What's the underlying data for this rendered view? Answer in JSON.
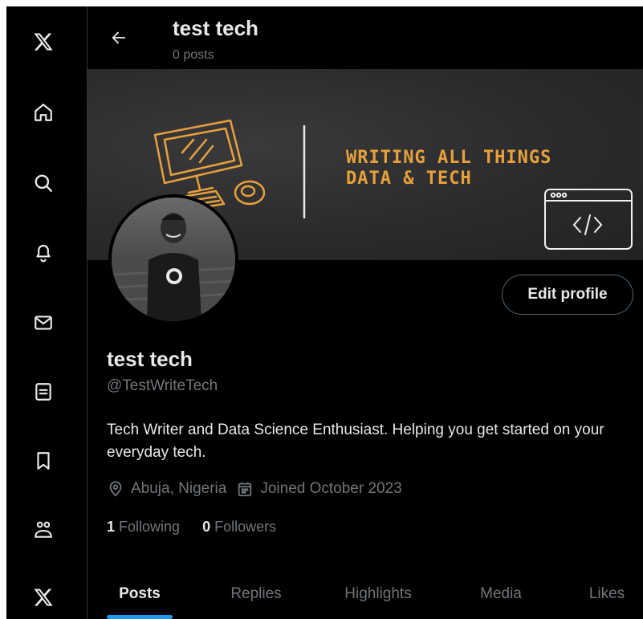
{
  "header": {
    "title": "test tech",
    "post_count": "0 posts"
  },
  "banner": {
    "line1": "WRITING ALL THINGS",
    "line2": "DATA & TECH",
    "accent_color": "#e8a13a"
  },
  "sidebar": {
    "items": [
      {
        "icon": "x-logo-icon"
      },
      {
        "icon": "home-icon"
      },
      {
        "icon": "search-icon"
      },
      {
        "icon": "bell-icon"
      },
      {
        "icon": "mail-icon"
      },
      {
        "icon": "list-icon"
      },
      {
        "icon": "bookmark-icon"
      },
      {
        "icon": "communities-icon"
      },
      {
        "icon": "x-premium-icon"
      }
    ]
  },
  "profile": {
    "edit_label": "Edit profile",
    "name": "test tech",
    "handle": "@TestWriteTech",
    "bio": "Tech Writer and Data Science Enthusiast. Helping you get started on your everyday tech.",
    "location": "Abuja, Nigeria",
    "joined": "Joined October 2023",
    "following_count": "1",
    "following_label": "Following",
    "followers_count": "0",
    "followers_label": "Followers"
  },
  "tabs": [
    {
      "label": "Posts",
      "active": true
    },
    {
      "label": "Replies"
    },
    {
      "label": "Highlights"
    },
    {
      "label": "Media"
    },
    {
      "label": "Likes"
    }
  ],
  "colors": {
    "background": "#000000",
    "text": "#e7e9ea",
    "muted": "#71767b",
    "accent": "#1d9bf0",
    "border": "#2f3336"
  }
}
